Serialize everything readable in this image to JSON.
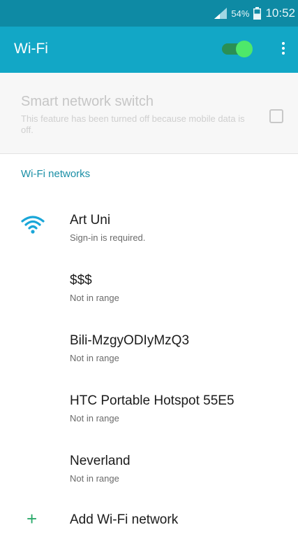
{
  "status_bar": {
    "battery": "54%",
    "time": "10:52"
  },
  "app_bar": {
    "title": "Wi-Fi",
    "wifi_toggle_on": true
  },
  "smart_switch": {
    "title": "Smart network switch",
    "description": "This feature has been turned off because mobile data is off.",
    "checked": false
  },
  "section_title": "Wi-Fi networks",
  "networks": [
    {
      "name": "Art Uni",
      "status": "Sign-in is required.",
      "icon": "wifi-signal-icon"
    },
    {
      "name": "$$$",
      "status": "Not in range"
    },
    {
      "name": "Bili-MzgyODIyMzQ3",
      "status": "Not in range"
    },
    {
      "name": "HTC Portable Hotspot 55E5",
      "status": "Not in range"
    },
    {
      "name": "Neverland",
      "status": "Not in range"
    }
  ],
  "add_network": {
    "label": "Add Wi-Fi network",
    "icon": "plus-icon"
  },
  "colors": {
    "status_bar": "#0e8aa4",
    "app_bar": "#12a7c6",
    "toggle_on": "#4ee86a",
    "section_title": "#1a8fa6",
    "wifi_icon": "#1aa6d8",
    "add_icon": "#2aa96a"
  }
}
